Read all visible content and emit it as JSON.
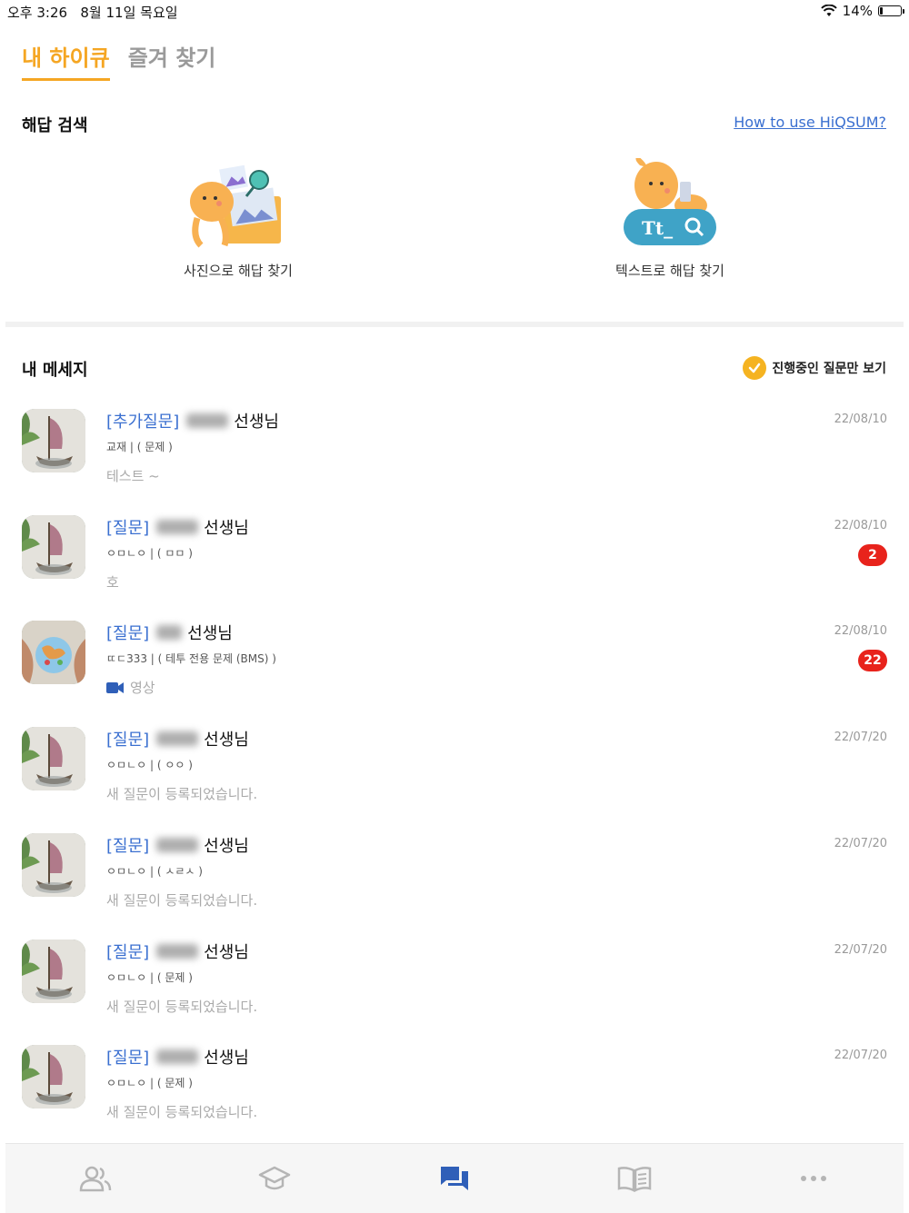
{
  "status": {
    "time": "오후 3:26",
    "date": "8월 11일 목요일",
    "battery": "14%"
  },
  "tabs": [
    {
      "label": "내 하이큐",
      "active": true
    },
    {
      "label": "즐겨 찾기",
      "active": false
    }
  ],
  "search": {
    "title": "해답 검색",
    "howto_link": "How to use HiQSUM?",
    "photo_label": "사진으로 해답 찾기",
    "text_label": "텍스트로 해답 찾기",
    "text_badge": "Tt_"
  },
  "messages_section": {
    "title": "내 메세지",
    "filter_label": "진행중인 질문만 보기",
    "filter_checked": true
  },
  "messages": [
    {
      "tag": "[추가질문]",
      "teacher": "선생님",
      "subject": "교재 | ( 문제 )",
      "preview": "테스트 ~",
      "date": "22/08/10",
      "badge": ""
    },
    {
      "tag": "[질문]",
      "teacher": "선생님",
      "subject": "ㅇㅁㄴㅇ | ( ㅁㅁ )",
      "preview": "호",
      "date": "22/08/10",
      "badge": "2"
    },
    {
      "tag": "[질문]",
      "teacher": "선생님",
      "subject": "ㄸㄷ333 | ( 테투 전용 문제 (BMS) )",
      "preview": "영상",
      "date": "22/08/10",
      "badge": "22"
    },
    {
      "tag": "[질문]",
      "teacher": "선생님",
      "subject": "ㅇㅁㄴㅇ | ( ㅇㅇ )",
      "preview": "새 질문이 등록되었습니다.",
      "date": "22/07/20",
      "badge": ""
    },
    {
      "tag": "[질문]",
      "teacher": "선생님",
      "subject": "ㅇㅁㄴㅇ | ( ㅅㄹㅅ )",
      "preview": "새 질문이 등록되었습니다.",
      "date": "22/07/20",
      "badge": ""
    },
    {
      "tag": "[질문]",
      "teacher": "선생님",
      "subject": "ㅇㅁㄴㅇ | ( 문제 )",
      "preview": "새 질문이 등록되었습니다.",
      "date": "22/07/20",
      "badge": ""
    },
    {
      "tag": "[질문]",
      "teacher": "선생님",
      "subject": "ㅇㅁㄴㅇ | ( 문제 )",
      "preview": "새 질문이 등록되었습니다.",
      "date": "22/07/20",
      "badge": ""
    }
  ],
  "bottom_nav": [
    {
      "icon": "people-icon",
      "active": false
    },
    {
      "icon": "graduation-cap-icon",
      "active": false
    },
    {
      "icon": "chat-icon",
      "active": true
    },
    {
      "icon": "book-icon",
      "active": false
    },
    {
      "icon": "more-icon",
      "active": false
    }
  ],
  "colors": {
    "accent": "#f5a623",
    "link": "#3a6fd0",
    "badge": "#e8231c",
    "nav_active": "#2f5fb8",
    "nav_inactive": "#b5b5b5"
  }
}
